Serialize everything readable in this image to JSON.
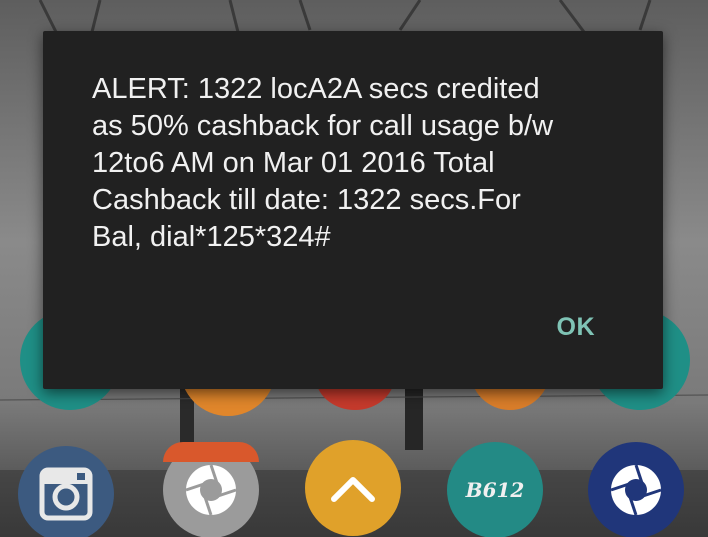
{
  "dialog": {
    "message": "ALERT: 1322 locA2A secs credited\nas 50% cashback for call usage b/w\n12to6 AM on Mar 01 2016 Total\nCashback till date: 1322 secs.For\nBal, dial*125*324#",
    "ok_label": "OK"
  },
  "dock": {
    "icons": [
      {
        "name": "instagram-icon"
      },
      {
        "name": "camera-icon"
      },
      {
        "name": "app-drawer-icon"
      },
      {
        "name": "b612-icon",
        "label": "B612"
      },
      {
        "name": "camera-icon"
      }
    ]
  },
  "colors": {
    "dialog_bg": "#212121",
    "message_text": "#f1f1f1",
    "accent": "#7fc3b5"
  }
}
